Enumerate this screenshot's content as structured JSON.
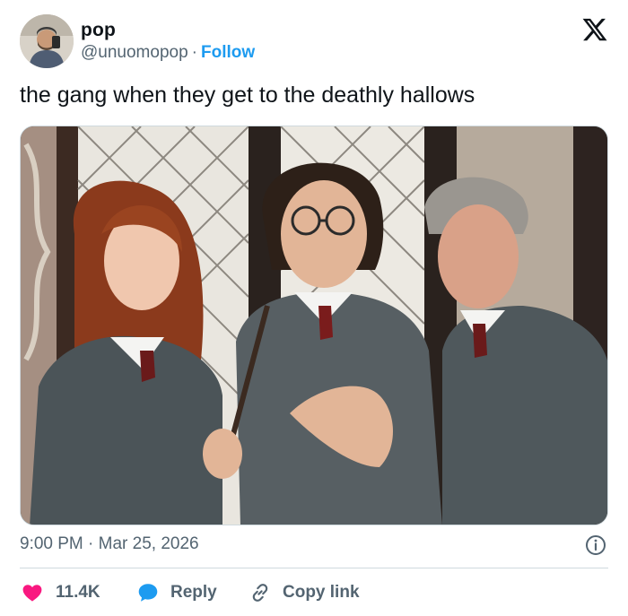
{
  "author": {
    "name": "pop",
    "handle": "@unuomopop",
    "separator": "·",
    "follow_label": "Follow"
  },
  "tweet": {
    "text": "the gang when they get to the deathly hallows",
    "timestamp": "9:00 PM · Mar 25, 2026"
  },
  "actions": {
    "like_count": "11.4K",
    "reply_label": "Reply",
    "copy_link_label": "Copy link"
  },
  "colors": {
    "accent": "#1d9bf0",
    "like": "#f91880",
    "secondary_text": "#536471",
    "primary_text": "#0f1419",
    "divider": "#cfd9de"
  },
  "icons": {
    "logo": "x-logo-icon",
    "info": "info-icon",
    "like": "heart-icon",
    "reply": "speech-bubble-icon",
    "copy": "link-icon"
  }
}
